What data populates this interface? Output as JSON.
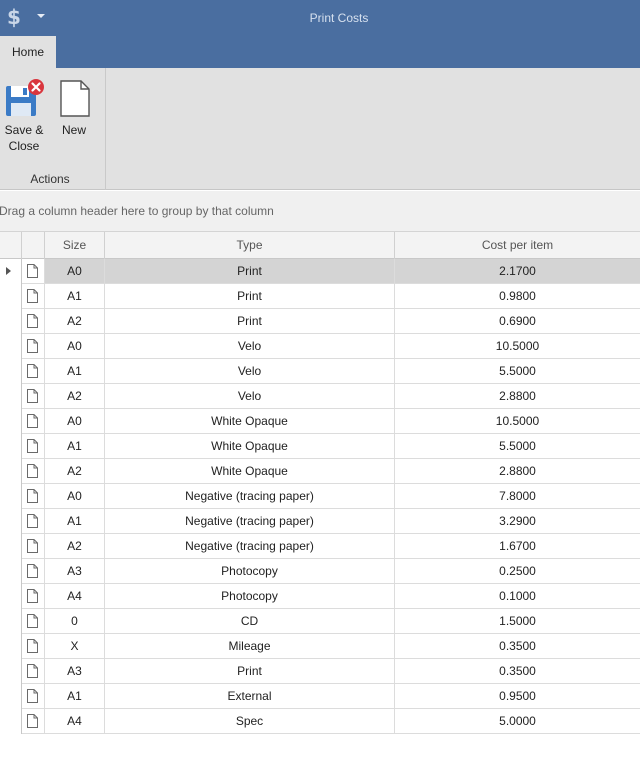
{
  "window": {
    "title": "Print Costs",
    "app_icon": "dollar-icon",
    "app_icon_glyph": "$"
  },
  "ribbon": {
    "tabs": [
      {
        "label": "Home",
        "active": true
      }
    ],
    "groups": [
      {
        "label": "Actions",
        "buttons": [
          {
            "label_line1": "Save &",
            "label_line2": "Close",
            "icon": "save-close-icon"
          },
          {
            "label": "New",
            "icon": "new-document-icon"
          }
        ]
      }
    ]
  },
  "group_panel": {
    "hint": "Drag a column header here to group by that column"
  },
  "grid": {
    "columns": [
      "Size",
      "Type",
      "Cost per item"
    ],
    "selected_row": 0,
    "rows": [
      {
        "size": "A0",
        "type": "Print",
        "cost": "2.1700"
      },
      {
        "size": "A1",
        "type": "Print",
        "cost": "0.9800"
      },
      {
        "size": "A2",
        "type": "Print",
        "cost": "0.6900"
      },
      {
        "size": "A0",
        "type": "Velo",
        "cost": "10.5000"
      },
      {
        "size": "A1",
        "type": "Velo",
        "cost": "5.5000"
      },
      {
        "size": "A2",
        "type": "Velo",
        "cost": "2.8800"
      },
      {
        "size": "A0",
        "type": "White Opaque",
        "cost": "10.5000"
      },
      {
        "size": "A1",
        "type": "White Opaque",
        "cost": "5.5000"
      },
      {
        "size": "A2",
        "type": "White Opaque",
        "cost": "2.8800"
      },
      {
        "size": "A0",
        "type": "Negative (tracing paper)",
        "cost": "7.8000"
      },
      {
        "size": "A1",
        "type": "Negative (tracing paper)",
        "cost": "3.2900"
      },
      {
        "size": "A2",
        "type": "Negative (tracing paper)",
        "cost": "1.6700"
      },
      {
        "size": "A3",
        "type": "Photocopy",
        "cost": "0.2500"
      },
      {
        "size": "A4",
        "type": "Photocopy",
        "cost": "0.1000"
      },
      {
        "size": "0",
        "type": "CD",
        "cost": "1.5000"
      },
      {
        "size": "X",
        "type": "Mileage",
        "cost": "0.3500"
      },
      {
        "size": "A3",
        "type": "Print",
        "cost": "0.3500"
      },
      {
        "size": "A1",
        "type": "External",
        "cost": "0.9500"
      },
      {
        "size": "A4",
        "type": "Spec",
        "cost": "5.0000"
      }
    ]
  },
  "colors": {
    "title_bar": "#4a6ea0",
    "ribbon": "#e1e1e1",
    "selected_row": "#d4d4d4"
  }
}
